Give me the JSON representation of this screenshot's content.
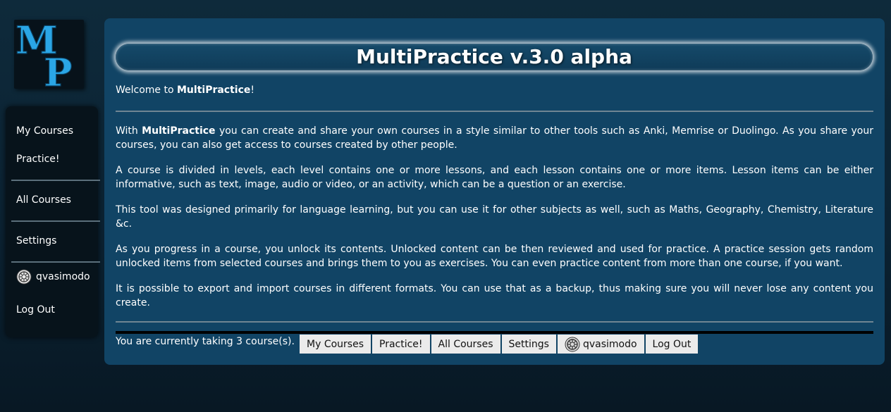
{
  "logo": {
    "letter_top": "M",
    "letter_bottom": "P",
    "icon": "mp-logo-icon"
  },
  "sidebar": {
    "items": [
      {
        "label": "My Courses"
      },
      {
        "label": "Practice!"
      },
      {
        "label": "All Courses"
      },
      {
        "label": "Settings"
      },
      {
        "label": "qvasimodo",
        "icon": "gear-icon"
      },
      {
        "label": "Log Out"
      }
    ]
  },
  "main": {
    "title": "MultiPractice v.3.0 alpha",
    "welcome_prefix": "Welcome to ",
    "welcome_name": "MultiPractice",
    "welcome_suffix": "!",
    "intro_prefix": "With ",
    "intro_name": "MultiPractice",
    "intro_rest": " you can create and share your own courses in a style similar to other tools such as Anki, Memrise or Duolingo. As you share your courses, you can also get access to courses created by other people.",
    "paragraphs": [
      "A course is divided in levels, each level contains one or more lessons, and each lesson contains one or more items. Lesson items can be either informative, such as text, image, audio or video, or an activity, which can be a question or an exercise.",
      "This tool was designed primarily for language learning, but you can use it for other subjects as well, such as Maths, Geography, Chemistry, Literature &c.",
      "As you progress in a course, you unlock its contents. Unlocked content can be then reviewed and used for practice. A practice session gets random unlocked items from selected courses and brings them to you as exercises. You can even practice content from more than one course, if you want.",
      "It is possible to export and import courses in different formats. You can use that as a backup, thus making sure you will never lose any content you create."
    ],
    "taking": "You are currently taking 3 course(s)."
  },
  "bottom_nav": {
    "items": [
      {
        "label": "My Courses"
      },
      {
        "label": "Practice!"
      },
      {
        "label": "All Courses"
      },
      {
        "label": "Settings"
      },
      {
        "label": "qvasimodo",
        "icon": "gear-icon"
      },
      {
        "label": "Log Out"
      }
    ]
  },
  "colors": {
    "panel": "#114465",
    "sidebar": "#07131b",
    "logo_blue": "#2aa6e6",
    "button_bg": "#ebebeb"
  }
}
